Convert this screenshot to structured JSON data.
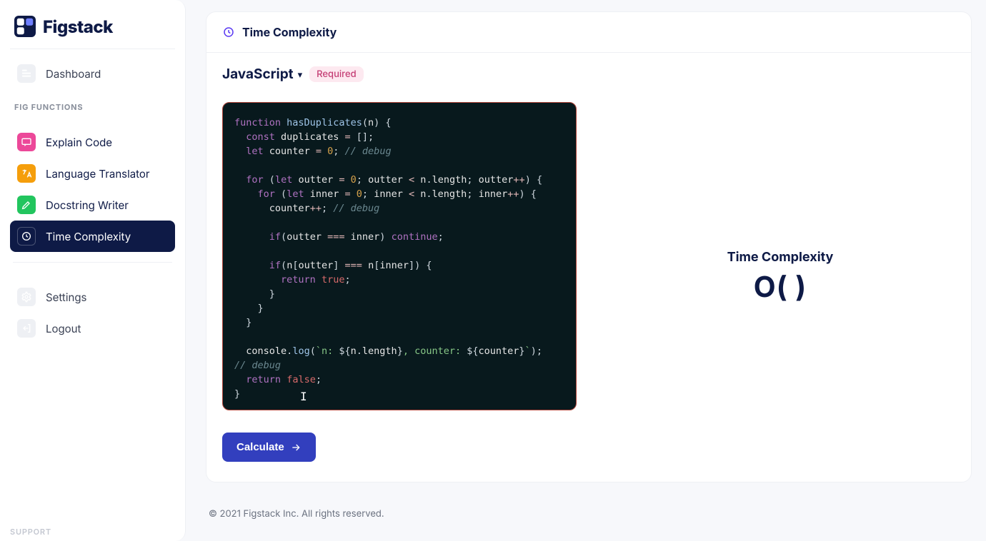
{
  "brand": {
    "name": "Figstack"
  },
  "sidebar": {
    "dashboard_label": "Dashboard",
    "section_title": "FIG FUNCTIONS",
    "items": [
      {
        "label": "Explain Code"
      },
      {
        "label": "Language Translator"
      },
      {
        "label": "Docstring Writer"
      },
      {
        "label": "Time Complexity"
      }
    ],
    "settings_label": "Settings",
    "logout_label": "Logout",
    "support_label": "SUPPORT"
  },
  "header": {
    "title": "Time Complexity"
  },
  "language": {
    "selected": "JavaScript",
    "badge": "Required"
  },
  "editor": {
    "code_plain": "function hasDuplicates(n) {\n  const duplicates = [];\n  let counter = 0; // debug\n\n  for (let outter = 0; outter < n.length; outter++) {\n    for (let inner = 0; inner < n.length; inner++) {\n      counter++; // debug\n\n      if(outter === inner) continue;\n\n      if(n[outter] === n[inner]) {\n        return true;\n      }\n    }\n  }\n\n  console.log(`n: ${n.length}, counter: ${counter}`);\n// debug\n  return false;\n}"
  },
  "buttons": {
    "calculate": "Calculate"
  },
  "result": {
    "title": "Time Complexity",
    "bigO": "O(  )"
  },
  "footer": {
    "text": "© 2021 Figstack Inc. All rights reserved."
  }
}
